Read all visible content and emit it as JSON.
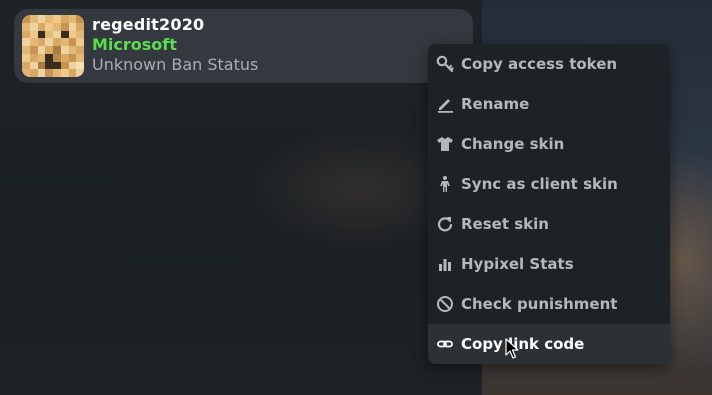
{
  "account": {
    "username": "regedit2020",
    "type": "Microsoft",
    "ban_status": "Unknown Ban Status"
  },
  "colors": {
    "account_type": "#5bdb4f",
    "menu_bg": "#1d2226",
    "menu_active_bg": "#2c3136",
    "menu_text": "#b4b8bc"
  },
  "context_menu": {
    "items": [
      {
        "label": "Copy access token",
        "icon": "key-icon"
      },
      {
        "label": "Rename",
        "icon": "pencil-icon"
      },
      {
        "label": "Change skin",
        "icon": "shirt-icon"
      },
      {
        "label": "Sync as client skin",
        "icon": "person-sync-icon"
      },
      {
        "label": "Reset skin",
        "icon": "reset-icon"
      },
      {
        "label": "Hypixel Stats",
        "icon": "bar-chart-icon"
      },
      {
        "label": "Check punishment",
        "icon": "ban-icon"
      },
      {
        "label": "Copy link code",
        "icon": "link-icon",
        "hovered": true
      }
    ]
  }
}
